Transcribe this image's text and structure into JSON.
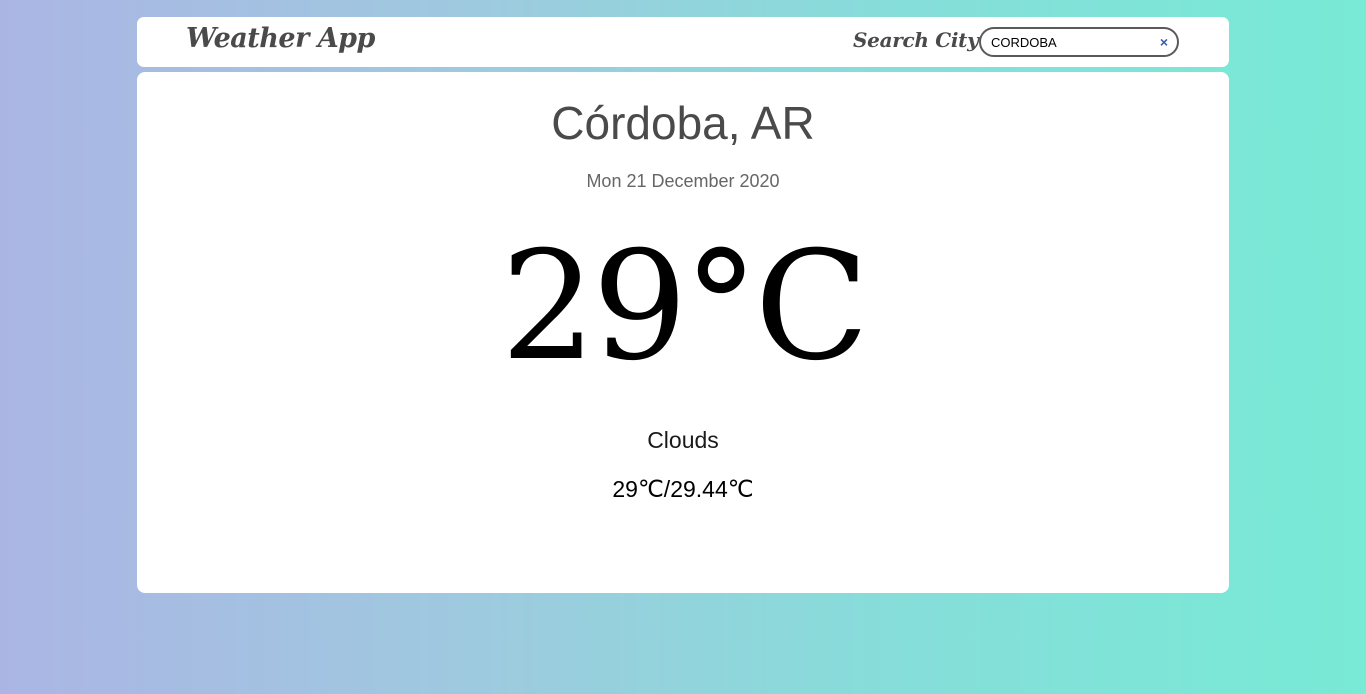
{
  "header": {
    "app_title": "Weather App",
    "search_label": "Search City:",
    "search_value": "CORDOBA",
    "clear_glyph": "×"
  },
  "weather": {
    "city": "Córdoba, AR",
    "date": "Mon 21 December 2020",
    "temperature": "29°C",
    "condition": "Clouds",
    "min_max": "29℃/29.44℃"
  },
  "colors": {
    "gradient_start": "#abb5e4",
    "gradient_end": "#78ead6",
    "card": "#ffffff",
    "clear_icon": "#3a5ba8"
  }
}
